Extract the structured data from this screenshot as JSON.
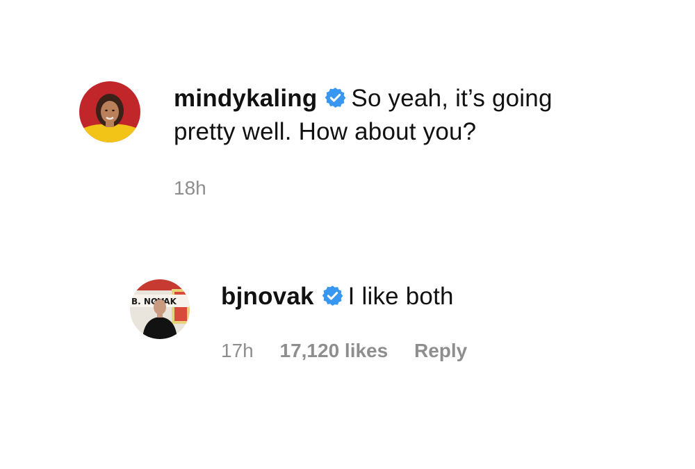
{
  "comments": [
    {
      "avatar": "mindykaling-avatar",
      "username": "mindykaling",
      "verified": true,
      "text": "So yeah, it’s going pretty well. How about you?",
      "timestamp": "18h"
    },
    {
      "avatar": "bjnovak-avatar",
      "avatar_caption": "B. NOVAK",
      "username": "bjnovak",
      "verified": true,
      "text": "I like both",
      "timestamp": "17h",
      "likes": "17,120 likes",
      "reply_label": "Reply"
    }
  ],
  "colors": {
    "verified_badge": "#3897f0",
    "meta_text": "#8e8e8e",
    "primary_text": "#111111"
  }
}
